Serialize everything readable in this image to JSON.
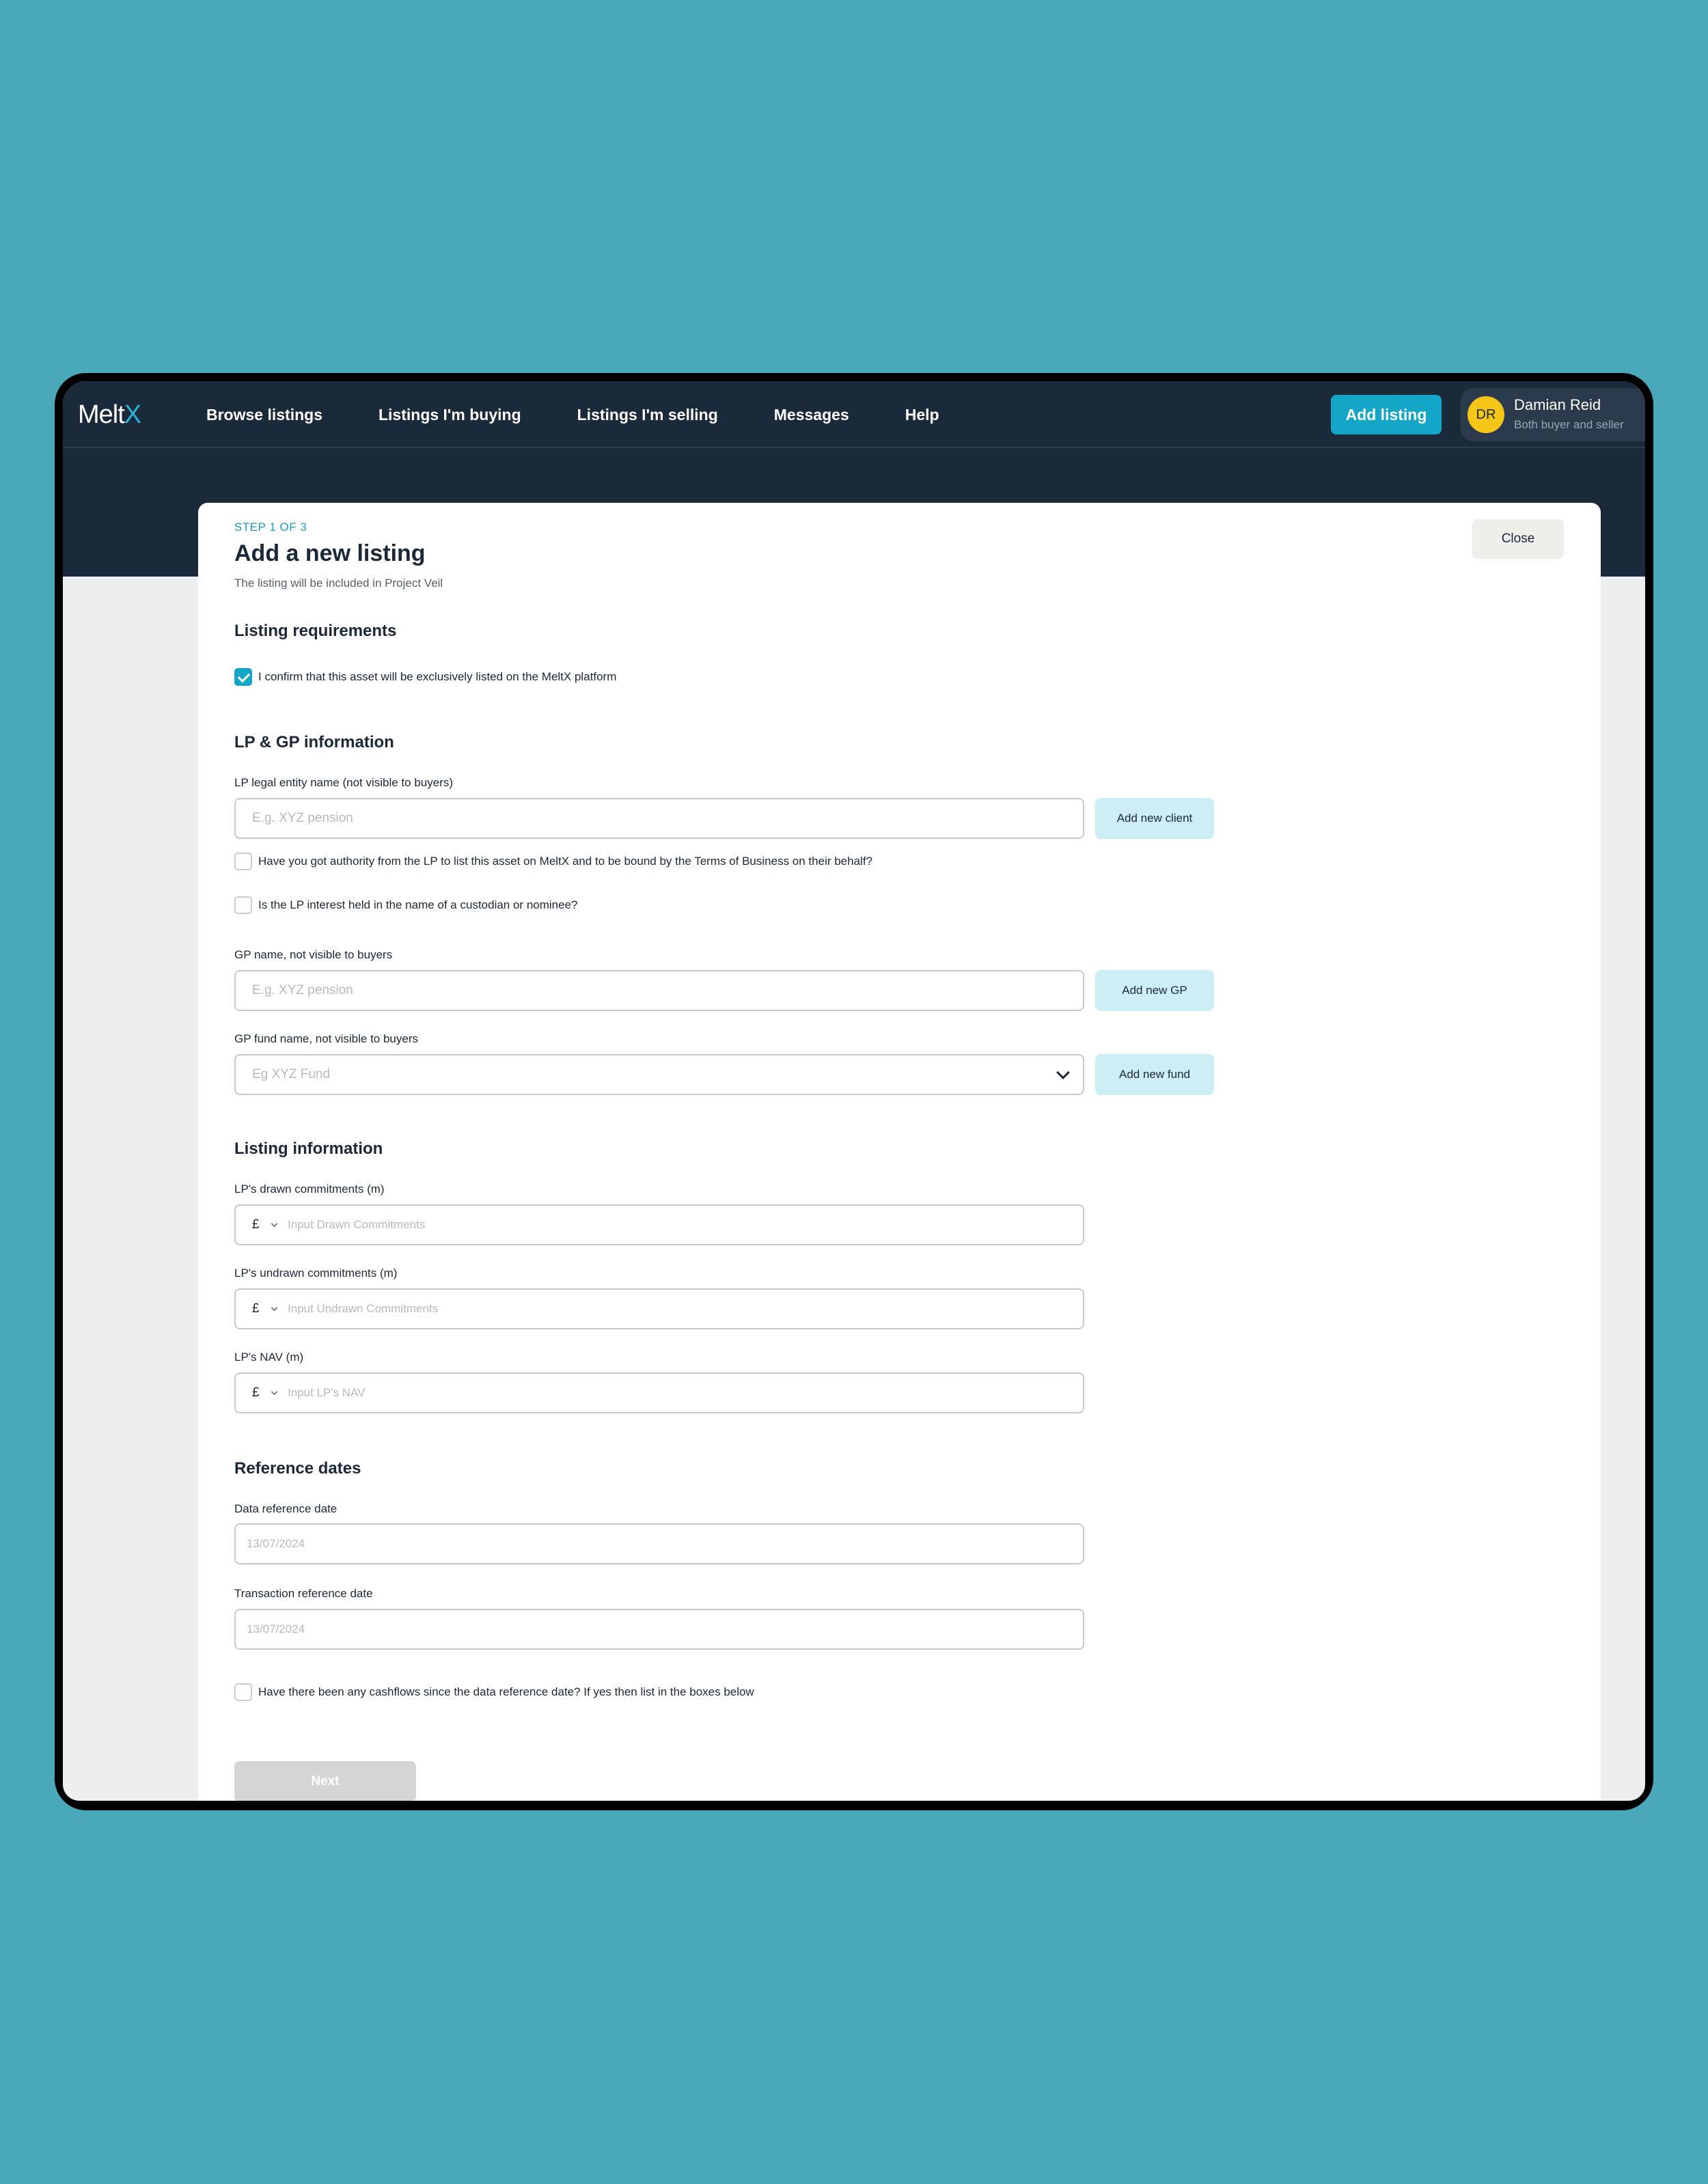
{
  "app": {
    "logo_text": "Melt",
    "logo_accent": "X"
  },
  "nav": {
    "items": [
      "Browse listings",
      "Listings I'm buying",
      "Listings I'm selling",
      "Messages",
      "Help"
    ],
    "add_listing_label": "Add listing"
  },
  "user": {
    "initials": "DR",
    "name": "Damian Reid",
    "role": "Both buyer and seller"
  },
  "form": {
    "step": "STEP 1 OF 3",
    "title": "Add a new listing",
    "subtitle": "The listing will be included in Project Veil",
    "close_label": "Close",
    "requirements": {
      "heading": "Listing requirements",
      "exclusive_confirm": {
        "label": "I confirm that this asset will be exclusively listed on the MeltX platform",
        "checked": true
      }
    },
    "lp_gp": {
      "heading": "LP & GP information",
      "lp_name_label": "LP legal entity name (not visible to buyers)",
      "lp_name_placeholder": "E.g. XYZ pension",
      "add_client_label": "Add new client",
      "authority": {
        "label": "Have you got authority from the LP to list this asset on MeltX and to be bound by the Terms of Business on their behalf?",
        "checked": false
      },
      "custodian": {
        "label": "Is the LP interest held in the name of a custodian or nominee?",
        "checked": false
      },
      "gp_name_label": "GP name, not visible to buyers",
      "gp_name_placeholder": "E.g. XYZ pension",
      "add_gp_label": "Add new GP",
      "gp_fund_label": "GP fund name, not visible to buyers",
      "gp_fund_placeholder": "Eg XYZ Fund",
      "add_fund_label": "Add new fund"
    },
    "listing_info": {
      "heading": "Listing information",
      "drawn_label": "LP's drawn commitments (m)",
      "drawn_currency": "£",
      "drawn_placeholder": "Input Drawn Commitments",
      "undrawn_label": "LP's undrawn commitments (m)",
      "undrawn_currency": "£",
      "undrawn_placeholder": "Input Undrawn Commitments",
      "nav_label": "LP's NAV (m)",
      "nav_currency": "£",
      "nav_placeholder": "Input LP's NAV"
    },
    "reference_dates": {
      "heading": "Reference dates",
      "data_date_label": "Data reference date",
      "data_date_placeholder": "13/07/2024",
      "transaction_date_label": "Transaction reference date",
      "transaction_date_placeholder": "13/07/2024"
    },
    "cashflows": {
      "label": "Have there been any cashflows since the data reference date? If yes then list in the boxes below",
      "checked": false
    },
    "next_label": "Next"
  },
  "colors": {
    "navbar": "#1b2a3b",
    "accent": "#13a6c6",
    "background": "#4aa8bb",
    "avatar": "#f5c518"
  }
}
